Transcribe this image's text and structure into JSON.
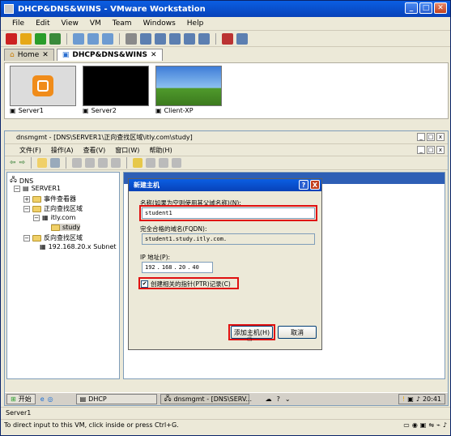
{
  "vmware": {
    "title": "DHCP&DNS&WINS - VMware Workstation",
    "menu": [
      "File",
      "Edit",
      "View",
      "VM",
      "Team",
      "Windows",
      "Help"
    ],
    "tabs": [
      {
        "label": "Home",
        "active": false
      },
      {
        "label": "DHCP&DNS&WINS",
        "active": true
      }
    ],
    "thumbnails": [
      {
        "label": "Server1"
      },
      {
        "label": "Server2"
      },
      {
        "label": "Client-XP"
      }
    ],
    "status_hint": "To direct input to this VM, click inside or press Ctrl+G.",
    "status_vm": "Server1"
  },
  "mmc": {
    "title": "dnsmgmt - [DNS\\SERVER1\\正向查找区域\\itly.com\\study]",
    "menu": [
      "文件(F)",
      "操作(A)",
      "查看(V)",
      "窗口(W)",
      "帮助(H)"
    ],
    "tree": [
      {
        "label": "DNS"
      },
      {
        "label": "SERVER1"
      },
      {
        "label": "事件查看器"
      },
      {
        "label": "正向查找区域"
      },
      {
        "label": "itly.com"
      },
      {
        "label": "study"
      },
      {
        "label": "反向查找区域"
      },
      {
        "label": "192.168.20.x Subnet"
      }
    ]
  },
  "dialog": {
    "title": "新建主机",
    "help": "?",
    "close": "X",
    "name_label": "名称(如果为空则使用其父域名称)(N):",
    "name_value": "student1",
    "fqdn_label": "完全合格的域名(FQDN):",
    "fqdn_value": "student1.study.itly.com.",
    "ip_label": "IP 地址(P):",
    "ip": [
      "192",
      "168",
      "20",
      "40"
    ],
    "ptr_label": "创建相关的指针(PTR)记录(C)",
    "ptr_checked": true,
    "add_button": "添加主机(H)",
    "cancel_button": "取消"
  },
  "taskbar": {
    "start": "开始",
    "items": [
      "DHCP",
      "dnsmgmt - [DNS\\SERV..."
    ],
    "time": "20:41"
  },
  "colors": {
    "titlebar": "#0a5ee3",
    "highlight_box": "#e01010"
  }
}
